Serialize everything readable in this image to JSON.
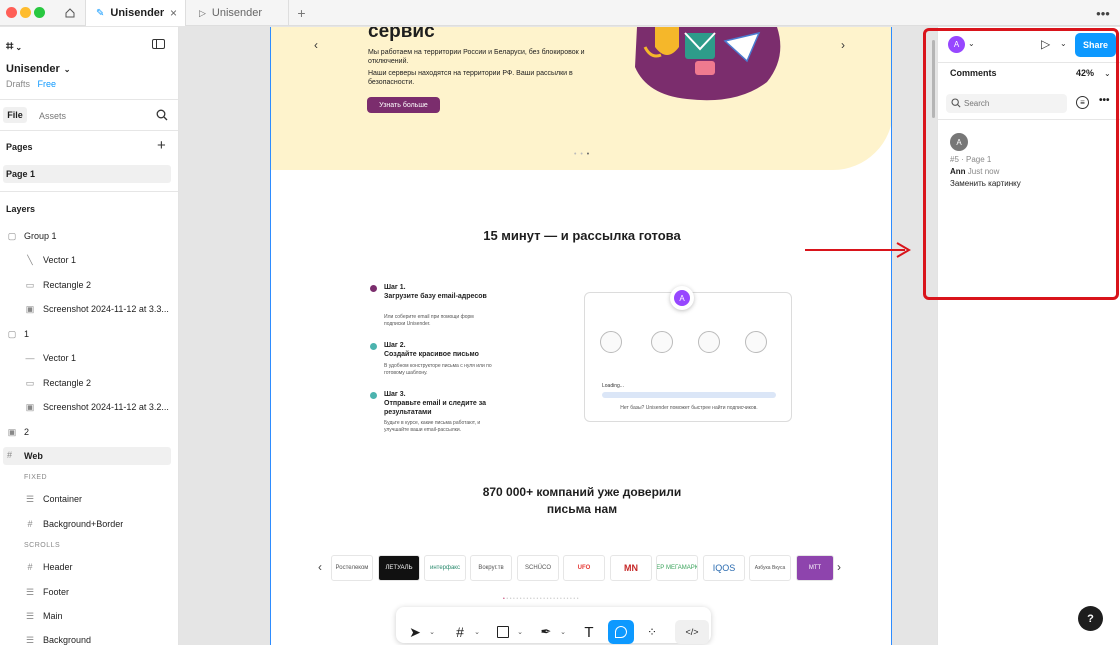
{
  "tabs": {
    "active_label": "Unisender",
    "inactive_label": "Unisender"
  },
  "left": {
    "file_name": "Unisender",
    "drafts": "Drafts",
    "plan_badge": "Free",
    "tab_file": "File",
    "tab_assets": "Assets",
    "pages_title": "Pages",
    "page_item": "Page 1",
    "layers_title": "Layers",
    "layers": [
      {
        "label": "Group 1",
        "icon": "group-icon"
      },
      {
        "label": "Vector 1",
        "icon": "vector-icon"
      },
      {
        "label": "Rectangle 2",
        "icon": "rectangle-icon"
      },
      {
        "label": "Screenshot 2024-11-12 at 3.3...",
        "icon": "image-icon"
      },
      {
        "label": "1",
        "icon": "group-icon"
      },
      {
        "label": "Vector 1",
        "icon": "line-icon"
      },
      {
        "label": "Rectangle 2",
        "icon": "rectangle-icon"
      },
      {
        "label": "Screenshot 2024-11-12 at 3.2...",
        "icon": "image-icon"
      },
      {
        "label": "2",
        "icon": "image-icon"
      },
      {
        "label": "Web",
        "icon": "frame-icon"
      },
      {
        "label": "Container",
        "icon": "frame-icon"
      },
      {
        "label": "Background+Border",
        "icon": "frame-icon"
      },
      {
        "label": "Header",
        "icon": "frame-icon"
      },
      {
        "label": "Footer",
        "icon": "frame-icon"
      },
      {
        "label": "Main",
        "icon": "frame-icon"
      },
      {
        "label": "Background",
        "icon": "frame-icon"
      }
    ],
    "caps_fixed": "FIXED",
    "caps_scrolls": "SCROLLS"
  },
  "site": {
    "hero_title": "сервис",
    "hero_p1": "Мы работаем на территории России и Беларуси, без блокировок и отключений.",
    "hero_p2": "Наши серверы находятся на территории РФ. Ваши рассылки в безопасности.",
    "hero_button": "Узнать больше",
    "section_title": "15 минут — и рассылка готова",
    "step1_title": "Шаг 1.\nЗагрузите базу email-адресов",
    "step1_desc": "Или соберите email при помощи форм подписки Unisender.",
    "step2_title": "Шаг 2.\nСоздайте красивое письмо",
    "step2_desc": "В удобном конструкторе письма с нуля или по готовому шаблону.",
    "step3_title": "Шаг 3.\nОтправьте email и следите за результатами",
    "step3_desc": "Будьте в курсе, какие письма работают, и улучшайте ваши email-рассылки.",
    "loading": "Loading...",
    "loading_note": "Нет базы? Unisender поможет быстрее найти подписчиков.",
    "companies_title": "870 000+ компаний уже доверили\nписьма нам",
    "logos": [
      "Ростелеком",
      "ЛЕТУАЛЬ",
      "интерфакс",
      "Вокруг.тв",
      "SCHÜCO",
      "UFO",
      "MN",
      "СБЕР МЕГАМАРКЕТ",
      "IQOS",
      "Азбука Вкуса",
      "МТТ"
    ],
    "comment_pin": "A"
  },
  "right": {
    "avatar_letter": "A",
    "share": "Share",
    "comments_title": "Comments",
    "zoom": "42%",
    "search_placeholder": "Search",
    "comment": {
      "avatar": "A",
      "meta": "#5 · Page 1",
      "author": "Ann",
      "time": "Just now",
      "text": "Заменить картинку"
    }
  },
  "help": "?",
  "colors": {
    "accent": "#0d99ff",
    "brand_purple": "#7b2d6d",
    "annotation_red": "#d9141b"
  }
}
